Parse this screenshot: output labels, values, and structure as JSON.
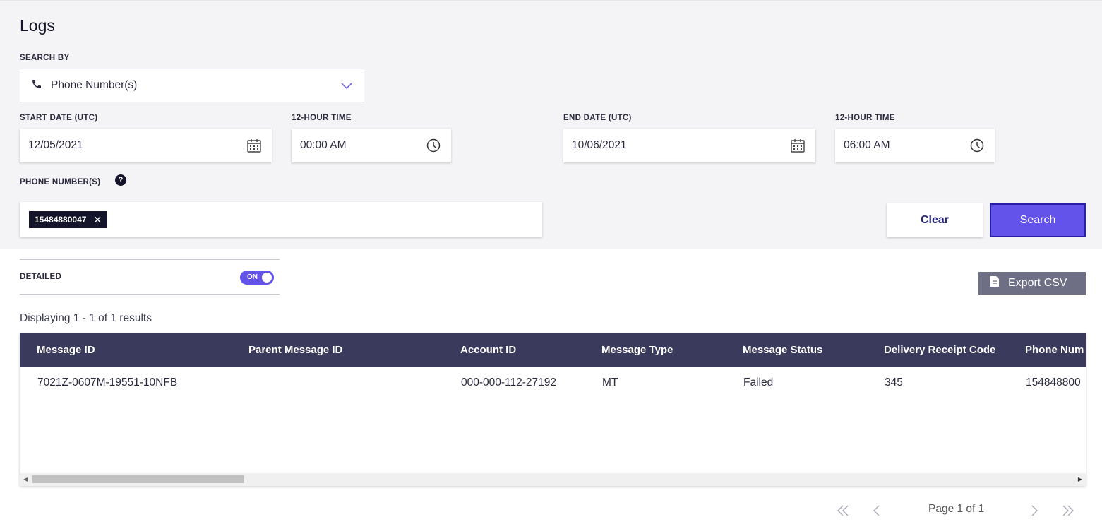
{
  "page": {
    "title": "Logs"
  },
  "search_by": {
    "label": "SEARCH BY",
    "value": "Phone Number(s)",
    "icon": "phone-icon"
  },
  "start": {
    "date_label": "START DATE (UTC)",
    "date": "12/05/2021",
    "time_label": "12-HOUR TIME",
    "time": "00:00 AM"
  },
  "end": {
    "date_label": "END DATE (UTC)",
    "date": "10/06/2021",
    "time_label": "12-HOUR TIME",
    "time": "06:00 AM"
  },
  "phones": {
    "label": "PHONE NUMBER(S)",
    "help": "?",
    "chips": [
      "15484880047"
    ]
  },
  "actions": {
    "clear": "Clear",
    "search": "Search"
  },
  "detailed": {
    "label": "DETAILED",
    "toggle": "ON"
  },
  "export": {
    "label": "Export CSV"
  },
  "results": {
    "summary": "Displaying 1 - 1 of 1 results"
  },
  "table": {
    "columns": [
      "Message ID",
      "Parent Message ID",
      "Account ID",
      "Message Type",
      "Message Status",
      "Delivery Receipt Code",
      "Phone Num"
    ],
    "rows": [
      [
        "7021Z-0607M-19551-10NFB",
        "",
        "000-000-112-27192",
        "MT",
        "Failed",
        "345",
        "154848800"
      ]
    ]
  },
  "pagination": {
    "text": "Page 1 of 1"
  },
  "colors": {
    "accent": "#6353ea",
    "header_bg": "#3a3a5c",
    "dark": "#14142b",
    "export_bg": "#6e6e85"
  }
}
